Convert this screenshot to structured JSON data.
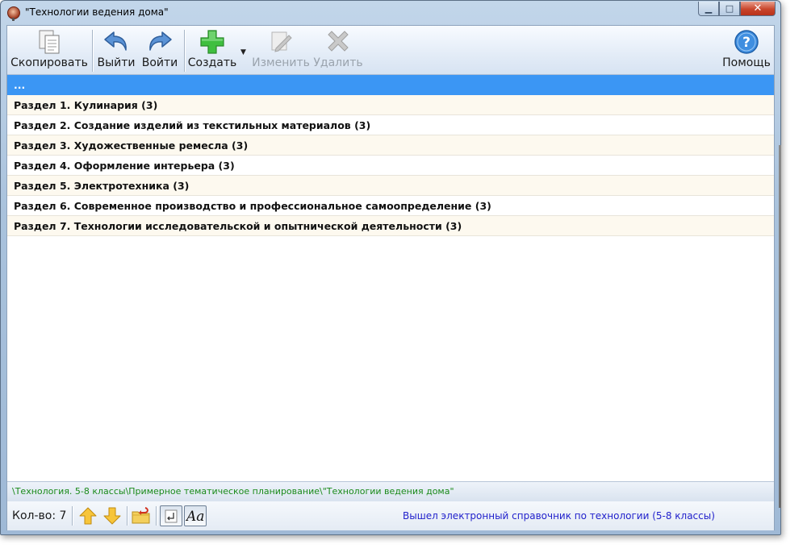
{
  "window": {
    "title": "\"Технологии ведения дома\"",
    "minimize_symbol": "▁",
    "maximize_symbol": "□",
    "close_symbol": "✕"
  },
  "toolbar": {
    "copy_label": "Скопировать",
    "exit_label": "Выйти",
    "enter_label": "Войти",
    "create_label": "Создать",
    "create_dropdown": "▼",
    "edit_label": "Изменить",
    "delete_label": "Удалить",
    "help_label": "Помощь"
  },
  "list": {
    "rows": [
      "...",
      "Раздел 1. Кулинария (3)",
      "Раздел 2. Создание изделий из текстильных материалов (3)",
      "Раздел 3. Художественные ремесла (3)",
      "Раздел 4. Оформление интерьера (3)",
      "Раздел 5. Электротехника (3)",
      "Раздел 6. Современное производство и профессиональное самоопределение (3)",
      "Раздел 7. Технологии исследовательской и опытнической деятельности (3)"
    ]
  },
  "path": "\\Технология. 5-8 классы\\Примерное тематическое планирование\\\"Технологии ведения дома\"",
  "status": {
    "count_label": "Кол-во: 7",
    "message": "Вышел электронный справочник по технологии (5-8 классы)"
  },
  "colors": {
    "selection": "#3b96f4",
    "path_text": "#1a8a1a",
    "status_text": "#2222cc"
  },
  "icons": [
    "copy-icon",
    "back-arrow-icon",
    "forward-arrow-icon",
    "plus-icon",
    "pencil-icon",
    "x-delete-icon",
    "help-icon",
    "arrow-up-icon",
    "arrow-down-icon",
    "folder-return-icon",
    "enter-key-icon",
    "font-icon"
  ]
}
